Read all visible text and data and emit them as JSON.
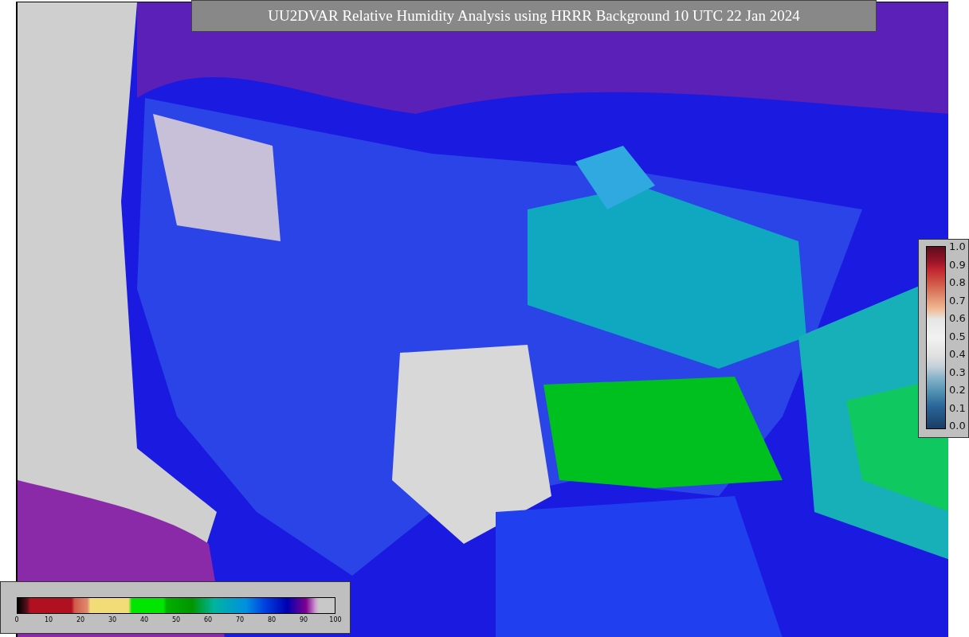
{
  "title": "UU2DVAR Relative Humidity Analysis using HRRR Background 10 UTC 22 Jan 2024",
  "humidity_scale": {
    "ticks": [
      "0",
      "10",
      "20",
      "30",
      "40",
      "50",
      "60",
      "70",
      "80",
      "90",
      "100"
    ]
  },
  "station_scale": {
    "ticks": [
      "1.0",
      "0.9",
      "0.8",
      "0.7",
      "0.6",
      "0.5",
      "0.4",
      "0.3",
      "0.2",
      "0.1",
      "0.0"
    ]
  }
}
